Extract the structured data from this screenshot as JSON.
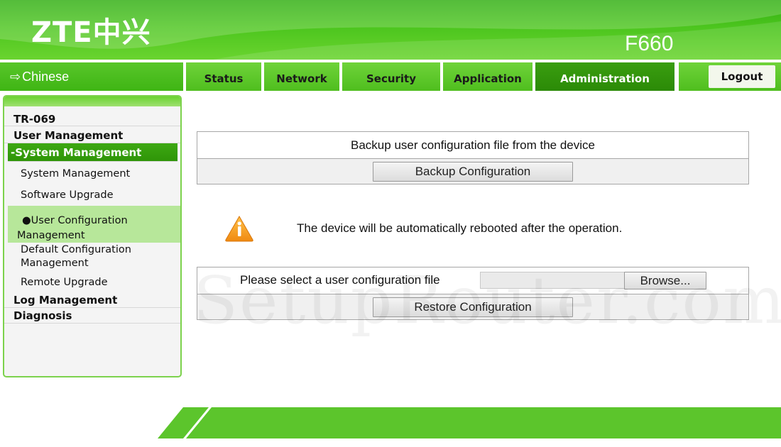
{
  "header": {
    "logo_text": "ZTE中兴",
    "model": "F660"
  },
  "language_link": {
    "icon": "arrow-right-icon",
    "label": "Chinese"
  },
  "tabs": [
    {
      "label": "Status",
      "active": false
    },
    {
      "label": "Network",
      "active": false
    },
    {
      "label": "Security",
      "active": false
    },
    {
      "label": "Application",
      "active": false
    },
    {
      "label": "Administration",
      "active": true
    }
  ],
  "logout_label": "Logout",
  "sidebar": {
    "tr069": "TR-069",
    "user_management": "User Management",
    "system_management": "-System Management",
    "sub_items": {
      "system_management": "System Management",
      "software_upgrade": "Software Upgrade",
      "user_config_line1": "User Configuration",
      "user_config_line2": "Management",
      "default_config_line1": "Default Configuration",
      "default_config_line2": "Management",
      "remote_upgrade": "Remote Upgrade"
    },
    "log_management": "Log Management",
    "diagnosis": "Diagnosis"
  },
  "backup": {
    "description": "Backup user configuration file from the device",
    "button_label": "Backup Configuration"
  },
  "warning": {
    "icon": "warning-icon",
    "text": "The device will be automatically rebooted after the operation."
  },
  "restore": {
    "file_label": "Please select a user configuration file",
    "file_value": "",
    "browse_label": "Browse...",
    "button_label": "Restore Configuration"
  },
  "watermark": "SetupRouter.com",
  "colors": {
    "brand_green": "#4cc51e",
    "active_tab": "#2b8a07",
    "selected_item": "#b7e79a"
  }
}
